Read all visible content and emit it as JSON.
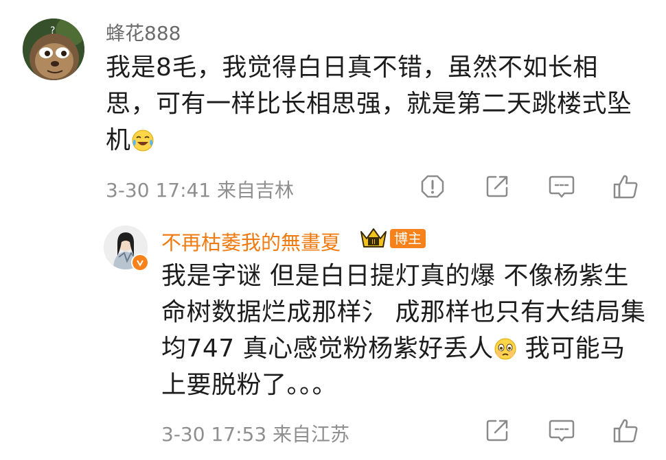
{
  "comment1": {
    "username": "蜂花888",
    "line1": "我是8毛，我觉得白日真不错，虽然不如长相",
    "line2": "思，可有一样比长相思强，就是第二天跳楼式坠",
    "line3": "机",
    "emoji": "laugh-cry-emoji",
    "meta": "3-30 17:41 来自吉林"
  },
  "reply1": {
    "username": "不再枯萎我的無畫夏",
    "badge": "博主",
    "line1": "我是字谜 但是白日提灯真的爆 不像杨紫生",
    "line2": "命树数据烂成那样氵 成那样也只有大结局集",
    "line3a": "均747  真心感觉粉杨紫好丢人",
    "line3b": " 我可能马",
    "line4": "上要脱粉了。。。",
    "emoji": "crying-emoji",
    "meta": "3-30 17:53 来自江苏"
  },
  "colors": {
    "username": "#6b6b6b",
    "blogger_name": "#f07b12",
    "meta": "#8f8f8f",
    "icon": "#8a8a8a"
  },
  "icons": [
    "report-icon",
    "repost-icon",
    "comment-icon",
    "like-icon"
  ]
}
